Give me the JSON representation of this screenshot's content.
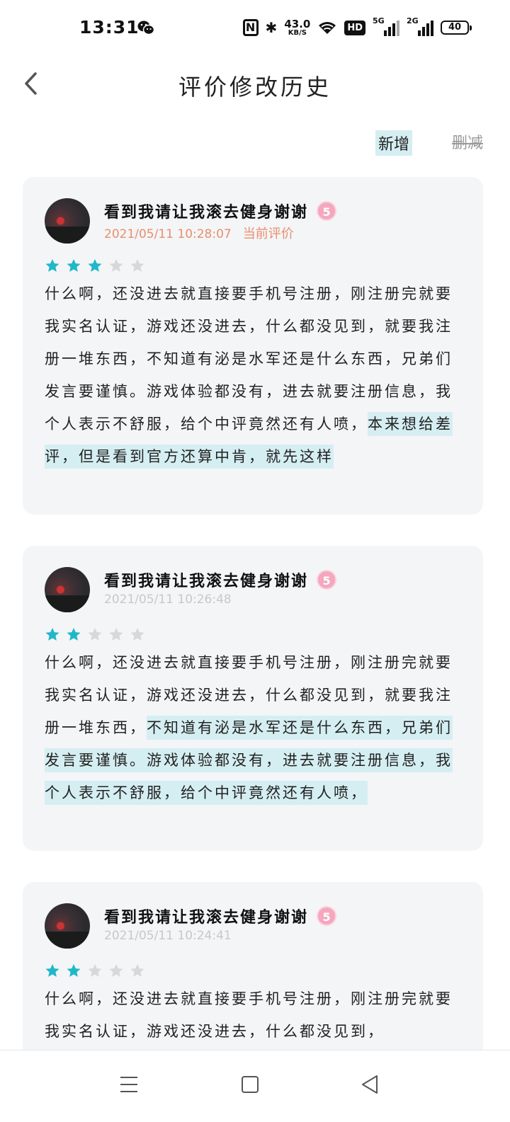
{
  "status": {
    "time": "13:31",
    "net_speed_value": "43.0",
    "net_speed_unit": "KB/S",
    "hd_label": "HD",
    "sig1_label": "5G",
    "sig2_label": "2G",
    "battery": "40"
  },
  "header": {
    "title": "评价修改历史"
  },
  "legend": {
    "add_label": "新增",
    "delete_label": "删减"
  },
  "reviews": [
    {
      "name": "看到我请让我滚去健身谢谢",
      "level": "5",
      "timestamp": "2021/05/11 10:28:07",
      "current_label": "当前评价",
      "rating": 3,
      "text_plain": "什么啊，还没进去就直接要手机号注册，刚注册完就要我实名认证，游戏还没进去，什么都没见到，就要我注册一堆东西，不知道有泌是水军还是什么东西，兄弟们发言要谨慎。游戏体验都没有，进去就要注册信息，我个人表示不舒服，给个中评竟然还有人喷，",
      "text_added": "本来想给差评，但是看到官方还算中肯，就先这样"
    },
    {
      "name": "看到我请让我滚去健身谢谢",
      "level": "5",
      "timestamp": "2021/05/11 10:26:48",
      "rating": 2,
      "text_plain": "什么啊，还没进去就直接要手机号注册，刚注册完就要我实名认证，游戏还没进去，什么都没见到，就要我注册一堆东西，",
      "text_added": "不知道有泌是水军还是什么东西，兄弟们发言要谨慎。游戏体验都没有，进去就要注册信息，我个人表示不舒服，给个中评竟然还有人喷，"
    },
    {
      "name": "看到我请让我滚去健身谢谢",
      "level": "5",
      "timestamp": "2021/05/11 10:24:41",
      "rating": 2,
      "text_plain": "什么啊，还没进去就直接要手机号注册，刚注册完就要我实名认证，游戏还没进去，什么都没见到，"
    }
  ],
  "colors": {
    "star_filled": "#1fb8c9",
    "star_empty": "#d8d8d8",
    "highlight_added": "#d5eef2",
    "accent_orange": "#e98e6d"
  },
  "nav": {
    "icons": [
      "menu-icon",
      "home-square-icon",
      "back-triangle-icon"
    ]
  }
}
